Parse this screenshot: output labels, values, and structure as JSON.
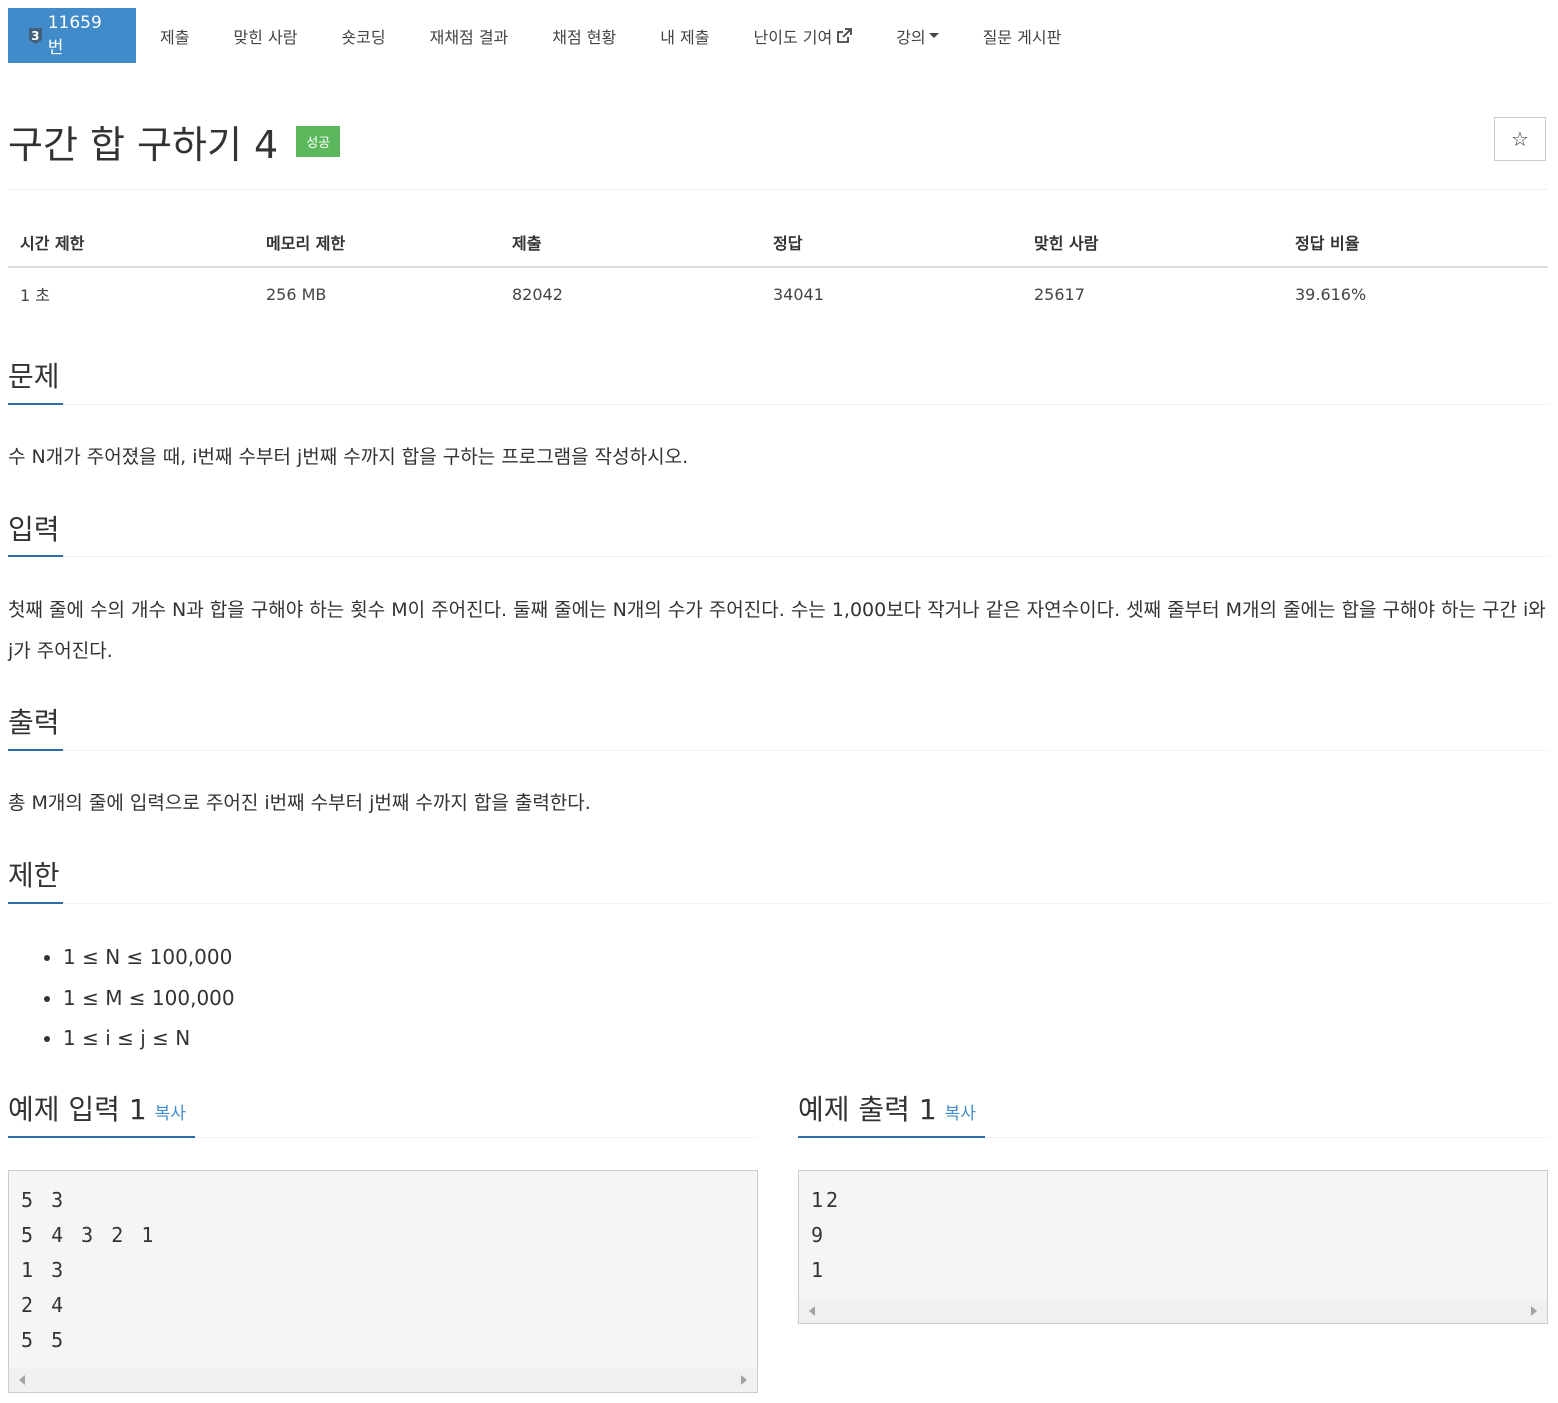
{
  "nav": {
    "problem_tier": "3",
    "problem_id": "11659번",
    "items": [
      "제출",
      "맞힌 사람",
      "숏코딩",
      "재채점 결과",
      "채점 현황",
      "내 제출",
      "난이도 기여",
      "강의",
      "질문 게시판"
    ]
  },
  "title": "구간 합 구하기 4",
  "status_badge": "성공",
  "star_icon": "☆",
  "stats": {
    "headers": [
      "시간 제한",
      "메모리 제한",
      "제출",
      "정답",
      "맞힌 사람",
      "정답 비율"
    ],
    "values": [
      "1 초",
      "256 MB",
      "82042",
      "34041",
      "25617",
      "39.616%"
    ]
  },
  "sections": {
    "problem": {
      "title": "문제",
      "text": "수 N개가 주어졌을 때, i번째 수부터 j번째 수까지 합을 구하는 프로그램을 작성하시오."
    },
    "input": {
      "title": "입력",
      "text": "첫째 줄에 수의 개수 N과 합을 구해야 하는 횟수 M이 주어진다. 둘째 줄에는 N개의 수가 주어진다. 수는 1,000보다 작거나 같은 자연수이다. 셋째 줄부터 M개의 줄에는 합을 구해야 하는 구간 i와 j가 주어진다."
    },
    "output": {
      "title": "출력",
      "text": "총 M개의 줄에 입력으로 주어진 i번째 수부터 j번째 수까지 합을 출력한다."
    },
    "limit": {
      "title": "제한",
      "items": [
        "1 ≤ N ≤ 100,000",
        "1 ≤ M ≤ 100,000",
        "1 ≤ i ≤ j ≤ N"
      ]
    }
  },
  "sample_input": {
    "title": "예제 입력 1",
    "copy": "복사",
    "lines": [
      "5 3",
      "5 4 3 2 1",
      "1 3",
      "2 4",
      "5 5"
    ]
  },
  "sample_output": {
    "title": "예제 출력 1",
    "copy": "복사",
    "lines": [
      "12",
      "9",
      "1"
    ]
  },
  "colors": {
    "primary": "#428bca",
    "success": "#5cb85c",
    "section_underline": "#2e6da4"
  }
}
